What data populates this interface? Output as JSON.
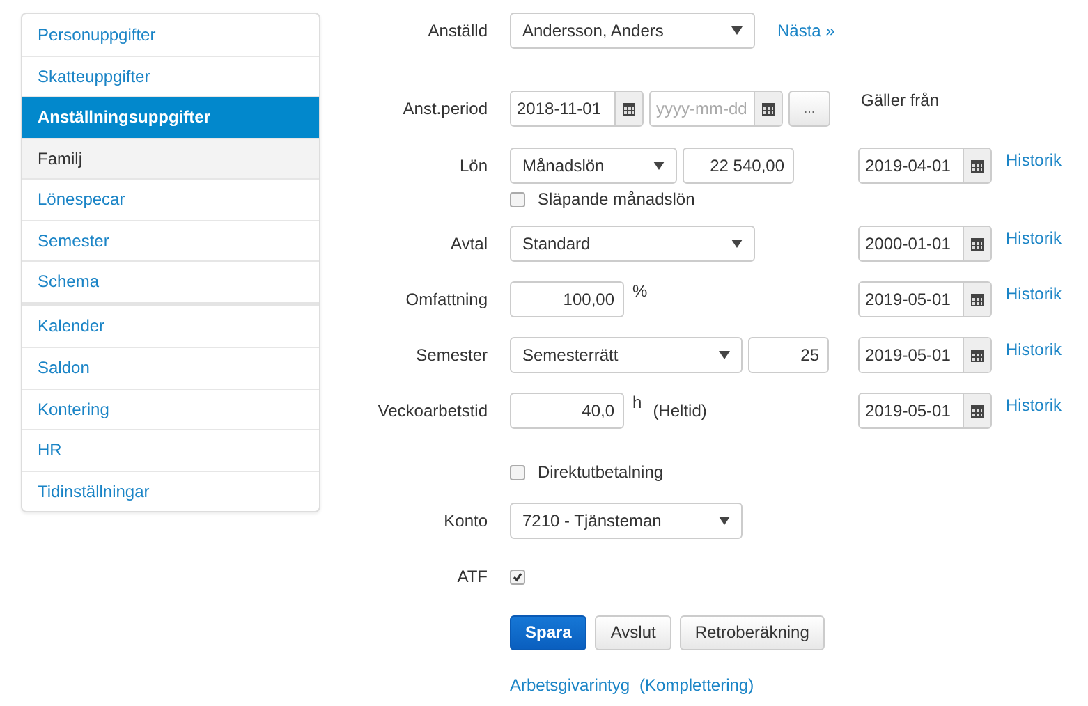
{
  "sidebar": {
    "groups": [
      {
        "items": [
          {
            "label": "Personuppgifter",
            "selected": false,
            "disabled": false
          },
          {
            "label": "Skatteuppgifter",
            "selected": false,
            "disabled": false
          },
          {
            "label": "Anställningsuppgifter",
            "selected": true,
            "disabled": false
          },
          {
            "label": "Familj",
            "selected": false,
            "disabled": true
          },
          {
            "label": "Lönespecar",
            "selected": false,
            "disabled": false
          },
          {
            "label": "Semester",
            "selected": false,
            "disabled": false
          },
          {
            "label": "Schema",
            "selected": false,
            "disabled": false
          }
        ]
      },
      {
        "items": [
          {
            "label": "Kalender",
            "selected": false,
            "disabled": false
          },
          {
            "label": "Saldon",
            "selected": false,
            "disabled": false
          },
          {
            "label": "Kontering",
            "selected": false,
            "disabled": false
          },
          {
            "label": "HR",
            "selected": false,
            "disabled": false
          },
          {
            "label": "Tidinställningar",
            "selected": false,
            "disabled": false
          }
        ]
      }
    ]
  },
  "employee": {
    "label": "Anställd",
    "value": "Andersson, Anders",
    "next_link": "Nästa »"
  },
  "period": {
    "label": "Anst.period",
    "start": "2018-11-01",
    "end_placeholder": "yyyy-mm-dd",
    "more_button": "...",
    "valid_from_header": "Gäller från"
  },
  "rows": [
    {
      "kind": "select_amount",
      "label": "Lön",
      "value": "Månadslön",
      "amount": "22 540,00",
      "date": "2019-04-01",
      "history_link": "Historik"
    },
    {
      "kind": "checkbox",
      "label": "Släpande månadslön",
      "checked": false
    },
    {
      "kind": "select",
      "label": "Avtal",
      "value": "Standard",
      "date": "2000-01-01",
      "history_link": "Historik"
    },
    {
      "kind": "number_unit",
      "label": "Omfattning",
      "value": "100,00",
      "unit": "%",
      "date": "2019-05-01",
      "history_link": "Historik"
    },
    {
      "kind": "select_amount",
      "label": "Semester",
      "value": "Semesterrätt",
      "amount": "25",
      "date": "2019-05-01",
      "history_link": "Historik"
    },
    {
      "kind": "number_unit",
      "label": "Veckoarbetstid",
      "value": "40,0",
      "unit": "h",
      "note": "(Heltid)",
      "date": "2019-05-01",
      "history_link": "Historik"
    }
  ],
  "direct_payment": {
    "label": "Direktutbetalning",
    "checked": false
  },
  "account": {
    "label": "Konto",
    "value": "7210 - Tjänsteman"
  },
  "atf": {
    "label": "ATF",
    "checked": true
  },
  "buttons": [
    {
      "label": "Spara",
      "primary": true
    },
    {
      "label": "Avslut",
      "primary": false
    },
    {
      "label": "Retroberäkning",
      "primary": false
    }
  ],
  "links": [
    "Arbetsgivarintyg",
    "(Komplettering)"
  ]
}
